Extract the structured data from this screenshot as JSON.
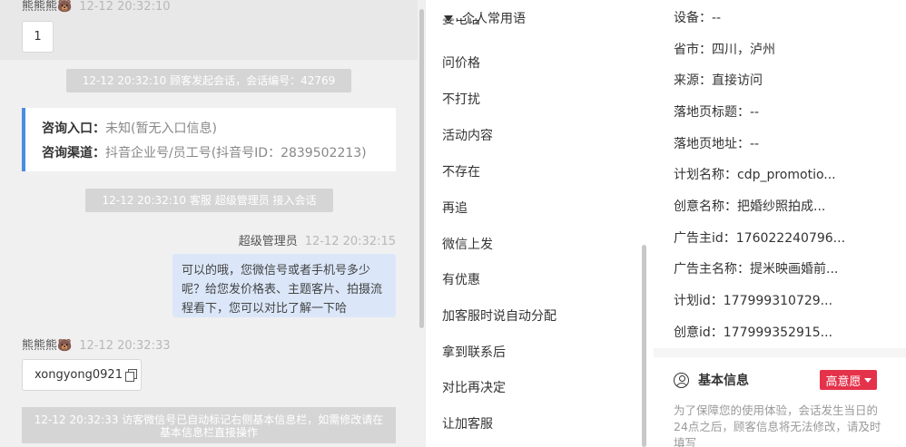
{
  "chat": {
    "visitor_name": "熊熊熊",
    "visitor_emoji": "🐻",
    "msg1": {
      "time": "12-12 20:32:10",
      "text": "1"
    },
    "sys_start": "12-12 20:32:10 顾客发起会话，会话编号：42769",
    "entry": {
      "label": "咨询入口：",
      "value": "未知(暂无入口信息)"
    },
    "channel": {
      "label": "咨询渠道：",
      "value": "抖音企业号/员工号(抖音号ID：2839502213)"
    },
    "sys_join": "12-12 20:32:10 客服 超级管理员 接入会话",
    "agent": {
      "name": "超级管理员",
      "time": "12-12 20:32:15",
      "text": "可以的哦，您微信号或者手机号多少呢？给您发价格表、主题客片、拍摄流程看下，您可以对比了解一下哈"
    },
    "msg2": {
      "time": "12-12 20:32:33",
      "text": "xongyong0921"
    },
    "sys_wechat": "12-12 20:32:33 访客微信号已自动标记右侧基本信息栏，如需修改请在基本信息栏直接操作"
  },
  "phrases": {
    "header": "个人常用语",
    "cut_item": "要电话",
    "items": [
      "问价格",
      "不打扰",
      "活动内容",
      "不存在",
      "再追",
      "微信上发",
      "有优惠",
      "加客服时说自动分配",
      "拿到联系后",
      "对比再决定",
      "让加客服"
    ]
  },
  "info": {
    "fields": [
      "设备：--",
      "省市：四川，泸州",
      "来源：直接访问",
      "落地页标题：--",
      "落地页地址：--",
      "计划名称：cdp_promotio...",
      "创意名称：把婚纱照拍成...",
      "广告主id：176022240796...",
      "广告主名称：提米映画婚前...",
      "计划id：177999310729...",
      "创意id：177999352915..."
    ],
    "basic_title": "基本信息",
    "intent_badge": "高意愿",
    "notice": "为了保障您的使用体验，会话发生当日的24点之后，顾客信息将无法修改，请及时填写"
  }
}
